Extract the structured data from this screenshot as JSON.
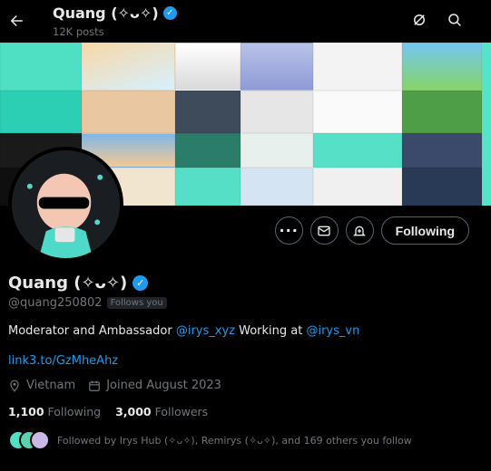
{
  "header": {
    "name": "Quang (✧ᴗ✧)",
    "posts": "12K posts"
  },
  "profile": {
    "name": "Quang (✧ᴗ✧)",
    "handle": "@quang250802",
    "follows_you": "Follows you",
    "bio": {
      "part1": "Moderator and Ambassador ",
      "mention1": "@irys_xyz",
      "part2": " Working at ",
      "mention2": "@irys_vn"
    },
    "link": "link3.to/GzMheAhz",
    "location": "Vietnam",
    "joined": "Joined August 2023",
    "following_count": "1,100",
    "following_label": "Following",
    "followers_count": "3,000",
    "followers_label": "Followers",
    "followed_by": "Followed by Irys Hub (✧ᴗ✧), Remirys (✧ᴗ✧), and 169 others you follow"
  },
  "actions": {
    "follow_label": "Following"
  },
  "icons": {
    "back": "back-arrow-icon",
    "grok": "grok-icon",
    "search": "search-icon",
    "more": "more-icon",
    "message": "mail-icon",
    "notify": "bell-plus-icon",
    "location": "location-pin-icon",
    "calendar": "calendar-icon"
  },
  "colors": {
    "accent": "#1d9bf0",
    "background": "#000000",
    "banner": "#56e4c8"
  }
}
